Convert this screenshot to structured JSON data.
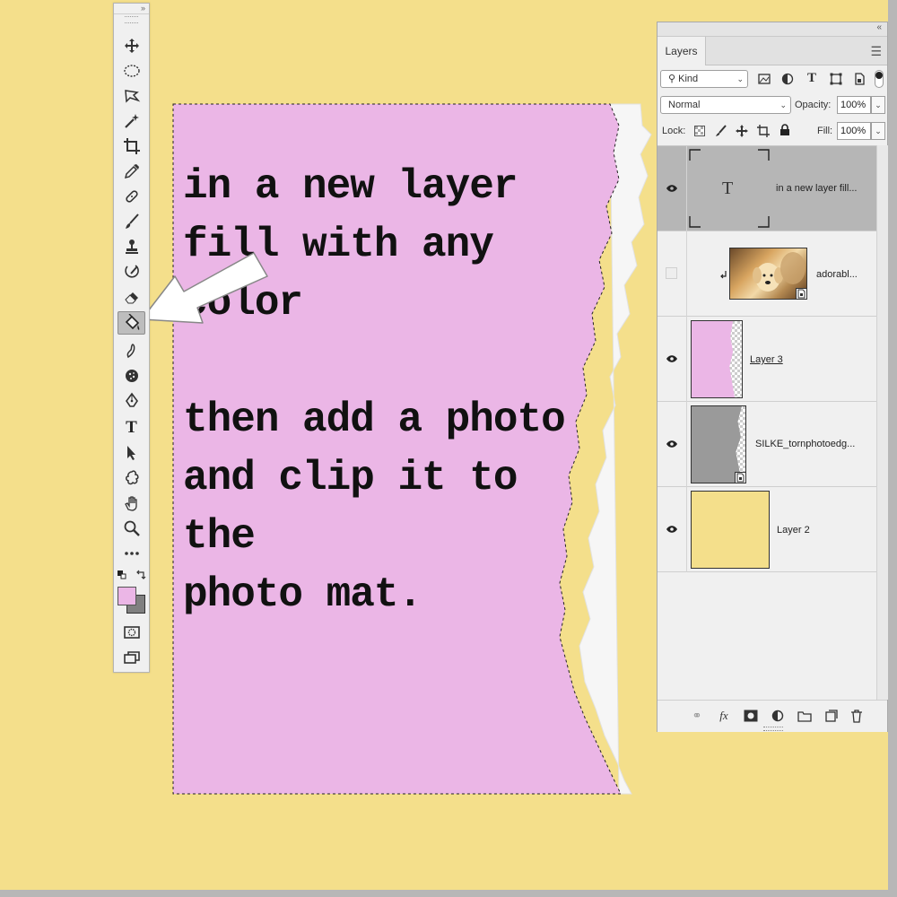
{
  "canvas": {
    "background": "#f4df8b",
    "mat_color": "#ebb6e6"
  },
  "mat_text": {
    "lines": "in a new layer\nfill with any color\n\nthen add a photo\nand clip it to the\nphoto mat."
  },
  "toolbar": {
    "collapse_label": "»",
    "tools": [
      {
        "name": "move-tool",
        "icon": "move-icon"
      },
      {
        "name": "marquee-tool",
        "icon": "elliptical-marquee-icon"
      },
      {
        "name": "lasso-tool",
        "icon": "polygonal-lasso-icon"
      },
      {
        "name": "magic-wand-tool",
        "icon": "magic-wand-icon"
      },
      {
        "name": "crop-tool",
        "icon": "crop-icon"
      },
      {
        "name": "eyedropper-tool",
        "icon": "eyedropper-icon"
      },
      {
        "name": "healing-brush-tool",
        "icon": "bandage-icon"
      },
      {
        "name": "brush-tool",
        "icon": "brush-icon"
      },
      {
        "name": "clone-stamp-tool",
        "icon": "stamp-icon"
      },
      {
        "name": "history-brush-tool",
        "icon": "history-brush-icon"
      },
      {
        "name": "eraser-tool",
        "icon": "eraser-icon"
      },
      {
        "name": "paint-bucket-tool",
        "icon": "paint-bucket-icon",
        "active": true
      },
      {
        "name": "smudge-tool",
        "icon": "smudge-icon"
      },
      {
        "name": "sponge-tool",
        "icon": "sponge-icon"
      },
      {
        "name": "pen-tool",
        "icon": "pen-icon"
      },
      {
        "name": "type-tool",
        "icon": "type-icon",
        "glyph": "T"
      },
      {
        "name": "path-selection-tool",
        "icon": "arrow-pointer-icon"
      },
      {
        "name": "custom-shape-tool",
        "icon": "custom-shape-icon"
      },
      {
        "name": "hand-tool",
        "icon": "hand-icon"
      },
      {
        "name": "zoom-tool",
        "icon": "zoom-icon"
      },
      {
        "name": "more-tools",
        "icon": "ellipsis-icon"
      }
    ],
    "foreground_color": "#ebb6e6",
    "background_color": "#808080"
  },
  "layers_panel": {
    "collapse_label": "«",
    "tab_label": "Layers",
    "filter_label": "Kind",
    "blend_mode": "Normal",
    "opacity_label": "Opacity:",
    "opacity_value": "100%",
    "lock_label": "Lock:",
    "fill_label": "Fill:",
    "fill_value": "100%",
    "layers": [
      {
        "name": "in a new layer fill...",
        "type": "text",
        "visible": true,
        "selected": true,
        "thumb_glyph": "T"
      },
      {
        "name": "adorabl...",
        "type": "smart-object-photo",
        "visible": false,
        "clipped": true
      },
      {
        "name": "Layer 3",
        "type": "pixel",
        "visible": true,
        "thumb_color": "#ebb6e6"
      },
      {
        "name": "SILKE_tornphotoedg...",
        "type": "smart-object",
        "visible": true,
        "thumb_color": "#9a9a9a"
      },
      {
        "name": "Layer 2",
        "type": "pixel",
        "visible": true,
        "thumb_color": "#f4df8b"
      }
    ]
  }
}
